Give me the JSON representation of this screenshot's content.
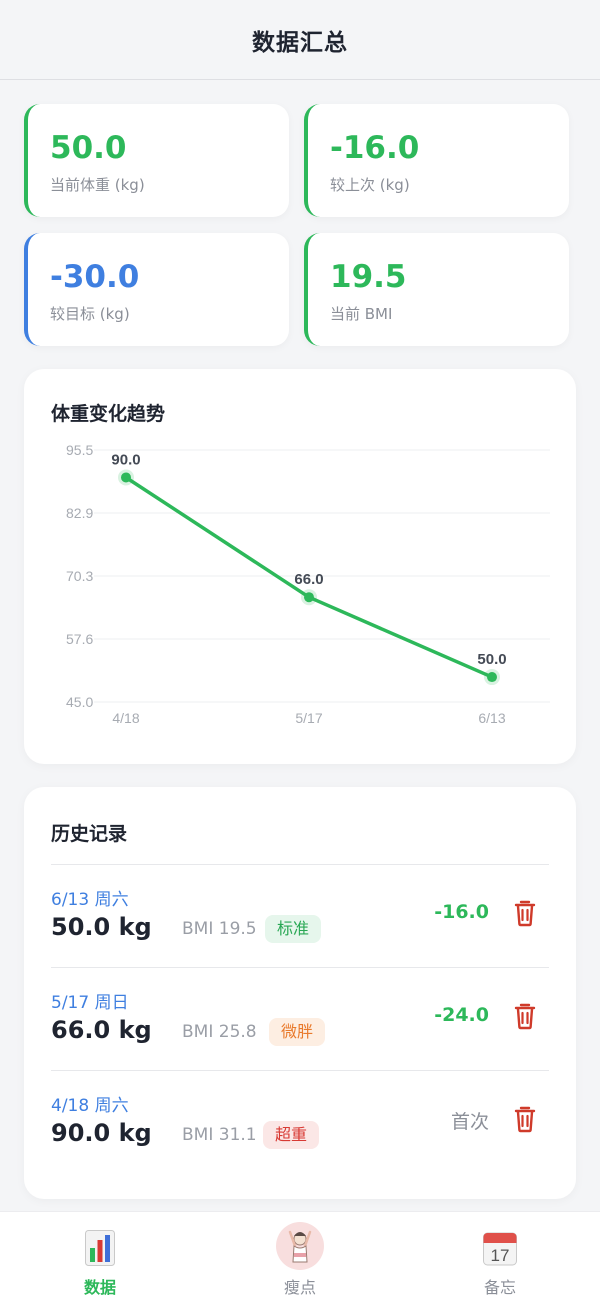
{
  "header": {
    "title": "数据汇总"
  },
  "stats": [
    {
      "value": "50.0",
      "label": "当前体重 (kg)",
      "color": "#2db85a"
    },
    {
      "value": "-16.0",
      "label": "较上次 (kg)",
      "color": "#2db85a"
    },
    {
      "value": "-30.0",
      "label": "较目标 (kg)",
      "color": "#3f7fe0"
    },
    {
      "value": "19.5",
      "label": "当前 BMI",
      "color": "#2db85a"
    }
  ],
  "trend": {
    "title": "体重变化趋势"
  },
  "chart_data": {
    "type": "line",
    "title": "体重变化趋势",
    "x": [
      "4/18",
      "5/17",
      "6/13"
    ],
    "series": [
      {
        "values": [
          90.0,
          66.0,
          50.0
        ]
      }
    ],
    "point_labels": [
      "90.0",
      "66.0",
      "50.0"
    ],
    "y_ticks": [
      "95.5",
      "82.9",
      "70.3",
      "57.6",
      "45.0"
    ],
    "ylim": [
      45.0,
      95.5
    ],
    "grid": true,
    "line_color": "#2db85a"
  },
  "history": {
    "title": "历史记录",
    "records": [
      {
        "date": "6/13 周六",
        "weight": "50.0 kg",
        "bmi": "BMI 19.5",
        "tag": "标准",
        "tag_style": "green",
        "change": "-16.0"
      },
      {
        "date": "5/17 周日",
        "weight": "66.0 kg",
        "bmi": "BMI 25.8",
        "tag": "微胖",
        "tag_style": "orange",
        "change": "-24.0"
      },
      {
        "date": "4/18 周六",
        "weight": "90.0 kg",
        "bmi": "BMI 31.1",
        "tag": "超重",
        "tag_style": "red",
        "change": "首次"
      }
    ]
  },
  "tabs": [
    {
      "label": "数据",
      "icon": "bar-chart-icon",
      "active": true
    },
    {
      "label": "瘦点",
      "icon": "avatar-icon",
      "active": false
    },
    {
      "label": "备忘",
      "icon": "calendar-icon",
      "active": false
    }
  ],
  "calendar_icon_day": "17",
  "colors": {
    "accent_green": "#2db85a",
    "accent_blue": "#3f7fe0",
    "delete_red": "#cf3a2a"
  }
}
